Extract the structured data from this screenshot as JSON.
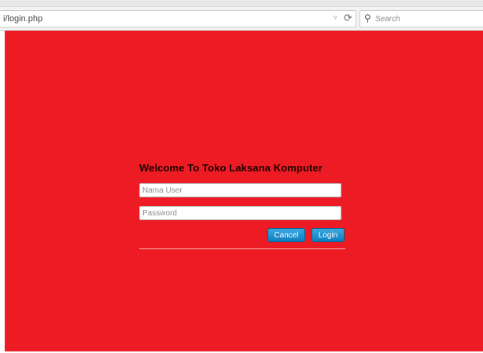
{
  "browser": {
    "url": "i/login.php",
    "search_placeholder": "Search",
    "icons": {
      "dropdown": "dropdown-arrow-icon",
      "reload": "reload-icon",
      "search": "search-icon"
    }
  },
  "page": {
    "background_color": "#ed1c24",
    "title": "Welcome To Toko  Laksana Komputer",
    "username_placeholder": "Nama User",
    "password_placeholder": "Password",
    "cancel_label": "Cancel",
    "login_label": "Login",
    "button_color": "#1a8bcb"
  }
}
